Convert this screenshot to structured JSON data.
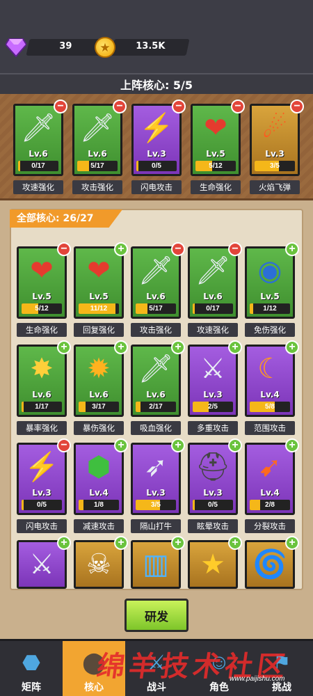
{
  "currency": {
    "gems": "39",
    "coins": "13.5K"
  },
  "deploy": {
    "title": "上阵核心: 5/5",
    "cards": [
      {
        "name": "攻速强化",
        "level": "Lv.6",
        "progress": "0/17",
        "fill": 0.0,
        "color": "green",
        "icon": "scythe-sword-icon",
        "badge": "minus"
      },
      {
        "name": "攻击强化",
        "level": "Lv.6",
        "progress": "5/17",
        "fill": 0.29,
        "color": "green",
        "icon": "sword-icon",
        "badge": "minus"
      },
      {
        "name": "闪电攻击",
        "level": "Lv.3",
        "progress": "0/5",
        "fill": 0.0,
        "color": "purple",
        "icon": "lightning-bow-icon",
        "badge": "minus"
      },
      {
        "name": "生命强化",
        "level": "Lv.5",
        "progress": "5/12",
        "fill": 0.42,
        "color": "green",
        "icon": "heart-icon",
        "badge": "minus"
      },
      {
        "name": "火焰飞弹",
        "level": "Lv.3",
        "progress": "3/5",
        "fill": 0.6,
        "color": "gold",
        "icon": "fireball-icon",
        "badge": "minus"
      }
    ]
  },
  "all": {
    "title": "全部核心: 26/27",
    "cards": [
      {
        "name": "生命强化",
        "level": "Lv.5",
        "progress": "5/12",
        "fill": 0.42,
        "color": "green",
        "icon": "heart-icon",
        "badge": "minus"
      },
      {
        "name": "回复强化",
        "level": "Lv.5",
        "progress": "11/12",
        "fill": 0.92,
        "color": "green",
        "icon": "heart-plus-icon",
        "badge": "plus"
      },
      {
        "name": "攻击强化",
        "level": "Lv.6",
        "progress": "5/17",
        "fill": 0.29,
        "color": "green",
        "icon": "sword-icon",
        "badge": "minus"
      },
      {
        "name": "攻速强化",
        "level": "Lv.6",
        "progress": "0/17",
        "fill": 0.0,
        "color": "green",
        "icon": "scythe-sword-icon",
        "badge": "minus"
      },
      {
        "name": "免伤强化",
        "level": "Lv.5",
        "progress": "1/12",
        "fill": 0.08,
        "color": "green",
        "icon": "shield-icon",
        "badge": "plus"
      },
      {
        "name": "暴率强化",
        "level": "Lv.6",
        "progress": "1/17",
        "fill": 0.06,
        "color": "green",
        "icon": "crit-sword-icon",
        "badge": "plus"
      },
      {
        "name": "暴伤强化",
        "level": "Lv.6",
        "progress": "3/17",
        "fill": 0.18,
        "color": "green",
        "icon": "burst-up-icon",
        "badge": "plus"
      },
      {
        "name": "吸血强化",
        "level": "Lv.6",
        "progress": "2/17",
        "fill": 0.12,
        "color": "green",
        "icon": "lifesteal-sword-icon",
        "badge": "plus"
      },
      {
        "name": "多重攻击",
        "level": "Lv.3",
        "progress": "2/5",
        "fill": 0.4,
        "color": "purple",
        "icon": "multi-sword-icon",
        "badge": "plus"
      },
      {
        "name": "范围攻击",
        "level": "Lv.4",
        "progress": "5/8",
        "fill": 0.62,
        "color": "purple",
        "icon": "area-sword-icon",
        "badge": "plus"
      },
      {
        "name": "闪电攻击",
        "level": "Lv.3",
        "progress": "0/5",
        "fill": 0.0,
        "color": "purple",
        "icon": "lightning-bow-icon",
        "badge": "minus"
      },
      {
        "name": "减速攻击",
        "level": "Lv.4",
        "progress": "1/8",
        "fill": 0.12,
        "color": "purple",
        "icon": "turtle-icon",
        "badge": "plus"
      },
      {
        "name": "隔山打牛",
        "level": "Lv.3",
        "progress": "3/5",
        "fill": 0.6,
        "color": "purple",
        "icon": "piercing-sword-icon",
        "badge": "plus"
      },
      {
        "name": "眩晕攻击",
        "level": "Lv.3",
        "progress": "0/5",
        "fill": 0.0,
        "color": "purple",
        "icon": "dizzy-helmet-icon",
        "badge": "plus"
      },
      {
        "name": "分裂攻击",
        "level": "Lv.4",
        "progress": "2/8",
        "fill": 0.25,
        "color": "purple",
        "icon": "split-arrow-icon",
        "badge": "plus"
      },
      {
        "name": "",
        "level": "",
        "progress": "",
        "fill": 0.0,
        "color": "purple",
        "icon": "double-sword-icon",
        "badge": "plus"
      },
      {
        "name": "",
        "level": "",
        "progress": "",
        "fill": 0.0,
        "color": "gold",
        "icon": "skull-icon",
        "badge": "plus"
      },
      {
        "name": "",
        "level": "",
        "progress": "",
        "fill": 0.0,
        "color": "gold",
        "icon": "canister-icon",
        "badge": "plus"
      },
      {
        "name": "",
        "level": "",
        "progress": "",
        "fill": 0.0,
        "color": "gold",
        "icon": "coin-up-icon",
        "badge": "plus"
      },
      {
        "name": "",
        "level": "",
        "progress": "",
        "fill": 0.0,
        "color": "gold",
        "icon": "vortex-icon",
        "badge": "plus"
      }
    ]
  },
  "research_button": "研发",
  "nav": [
    {
      "label": "矩阵",
      "icon": "matrix-icon",
      "active": false
    },
    {
      "label": "核心",
      "icon": "core-icon",
      "active": true
    },
    {
      "label": "战斗",
      "icon": "battle-icon",
      "active": false
    },
    {
      "label": "角色",
      "icon": "character-icon",
      "active": false
    },
    {
      "label": "挑战",
      "icon": "challenge-icon",
      "active": false
    }
  ],
  "watermark": {
    "text": "绵羊技术社区",
    "url": "www.paijishu.com"
  },
  "colors": {
    "green": "#4aa33a",
    "purple": "#8f47cc",
    "gold": "#c58c2c",
    "bar": "#f5b719",
    "accent": "#f19a2a"
  }
}
